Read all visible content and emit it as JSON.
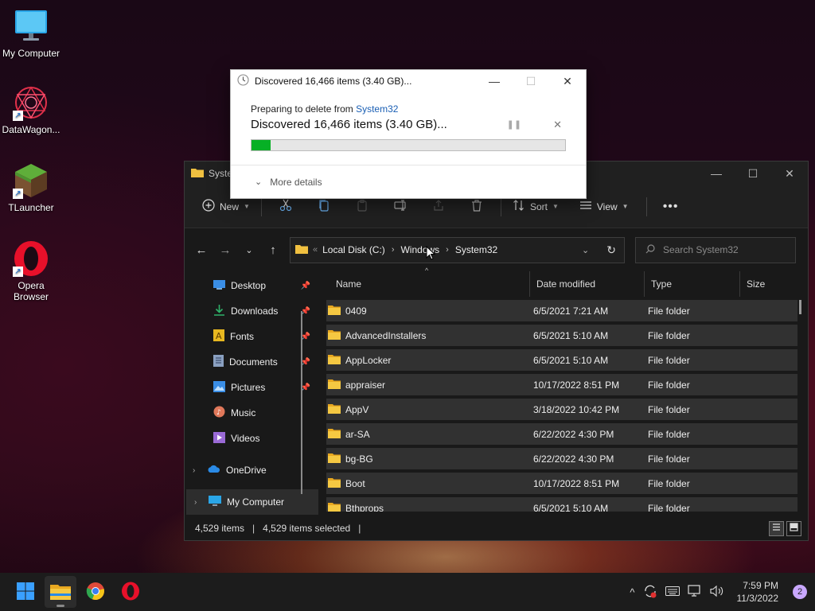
{
  "desktop": {
    "icons": [
      {
        "label": "My Computer",
        "icon": "monitor-icon"
      },
      {
        "label": "DataWagon...",
        "icon": "datawagon-icon"
      },
      {
        "label": "TLauncher",
        "icon": "tlauncher-icon"
      },
      {
        "label": "Opera Browser",
        "icon": "opera-icon"
      }
    ]
  },
  "dialog": {
    "title": "Discovered 16,466 items (3.40 GB)...",
    "sub_prefix": "Preparing to delete from",
    "sub_link": "System32",
    "main_text": "Discovered 16,466 items (3.40 GB)...",
    "progress": 0.06,
    "more_details": "More details",
    "colors": {
      "progress": "#06b025",
      "link": "#1a5fb4"
    }
  },
  "explorer": {
    "title": "System32",
    "toolbar": {
      "new_label": "New",
      "sort_label": "Sort",
      "view_label": "View",
      "icons": [
        "cut-icon",
        "copy-icon",
        "paste-icon",
        "rename-icon",
        "share-icon",
        "delete-icon"
      ]
    },
    "address": {
      "crumbs": [
        "Local Disk (C:)",
        "Windows",
        "System32"
      ]
    },
    "search": {
      "placeholder": "Search System32"
    },
    "nav": {
      "quick": [
        {
          "label": "Desktop",
          "pinned": true,
          "color": "#3a8ee6"
        },
        {
          "label": "Downloads",
          "pinned": true,
          "color": "#2fb36a"
        },
        {
          "label": "Fonts",
          "pinned": true,
          "color": "#e8b820"
        },
        {
          "label": "Documents",
          "pinned": true,
          "color": "#8aa0c0"
        },
        {
          "label": "Pictures",
          "pinned": true,
          "color": "#3a8ee6"
        },
        {
          "label": "Music",
          "pinned": false,
          "color": "#e0785a"
        },
        {
          "label": "Videos",
          "pinned": false,
          "color": "#9a6ad6"
        }
      ],
      "onedrive": "OneDrive",
      "mycomputer": "My Computer"
    },
    "columns": {
      "name": "Name",
      "date": "Date modified",
      "type": "Type",
      "size": "Size"
    },
    "files": [
      {
        "name": "0409",
        "date": "6/5/2021 7:21 AM",
        "type": "File folder"
      },
      {
        "name": "AdvancedInstallers",
        "date": "6/5/2021 5:10 AM",
        "type": "File folder"
      },
      {
        "name": "AppLocker",
        "date": "6/5/2021 5:10 AM",
        "type": "File folder"
      },
      {
        "name": "appraiser",
        "date": "10/17/2022 8:51 PM",
        "type": "File folder"
      },
      {
        "name": "AppV",
        "date": "3/18/2022 10:42 PM",
        "type": "File folder"
      },
      {
        "name": "ar-SA",
        "date": "6/22/2022 4:30 PM",
        "type": "File folder"
      },
      {
        "name": "bg-BG",
        "date": "6/22/2022 4:30 PM",
        "type": "File folder"
      },
      {
        "name": "Boot",
        "date": "10/17/2022 8:51 PM",
        "type": "File folder"
      },
      {
        "name": "Bthprops",
        "date": "6/5/2021 5:10 AM",
        "type": "File folder"
      }
    ],
    "status": {
      "items": "4,529 items",
      "selected": "4,529 items selected"
    }
  },
  "taskbar": {
    "apps": [
      "windows-start-icon",
      "file-explorer-icon",
      "chrome-icon",
      "opera-icon"
    ],
    "time": "7:59 PM",
    "date": "11/3/2022",
    "notifications": "2"
  }
}
